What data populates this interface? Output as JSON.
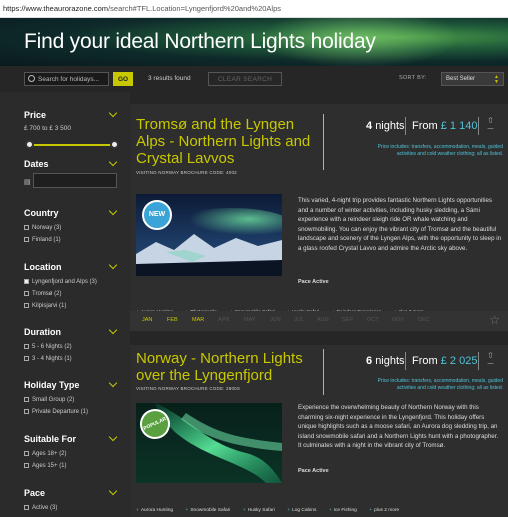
{
  "browser": {
    "url_host": "https://www.theaurorazone.com",
    "url_path": "/search#TFL.Location=Lyngenfjord%20and%20Alps"
  },
  "hero": {
    "title": "Find your ideal Northern Lights holiday"
  },
  "toolbar": {
    "search_placeholder": "Search for holidays...",
    "go_label": "GO",
    "results_text": "3 results found",
    "clear_label": "CLEAR SEARCH",
    "sort_label": "SORT BY:",
    "sort_value": "Best Seller"
  },
  "sidebar": {
    "price": {
      "title": "Price",
      "range": "£ 700 to £ 3 500"
    },
    "dates": {
      "title": "Dates"
    },
    "country": {
      "title": "Country",
      "options": [
        {
          "label": "Norway (3)",
          "checked": false
        },
        {
          "label": "Finland (1)",
          "checked": false
        }
      ]
    },
    "location": {
      "title": "Location",
      "options": [
        {
          "label": "Lyngenfjord and Alps (3)",
          "checked": true
        },
        {
          "label": "Tromsø (2)",
          "checked": false
        },
        {
          "label": "Kilpisjarvi (1)",
          "checked": false
        }
      ]
    },
    "duration": {
      "title": "Duration",
      "options": [
        {
          "label": "5 - 6 Nights (2)",
          "checked": false
        },
        {
          "label": "3 - 4 Nights (1)",
          "checked": false
        }
      ]
    },
    "holiday_type": {
      "title": "Holiday Type",
      "options": [
        {
          "label": "Small Group (2)",
          "checked": false
        },
        {
          "label": "Private Departure (1)",
          "checked": false
        }
      ]
    },
    "suitable_for": {
      "title": "Suitable For",
      "options": [
        {
          "label": "Ages 18+ (2)",
          "checked": false
        },
        {
          "label": "Ages 15+ (1)",
          "checked": false
        }
      ]
    },
    "pace": {
      "title": "Pace",
      "options": [
        {
          "label": "Active (3)",
          "checked": false
        }
      ]
    }
  },
  "cards": [
    {
      "title_lines": [
        "Tromsø and the Lyngen",
        "Alps - Northern Lights and",
        "Crystal Lavvos"
      ],
      "code": "VISITING NORWAY BROCHURE CODE: 4002",
      "nights_num": "4",
      "nights_word": "nights",
      "from_label": "From",
      "price": "£ 1 140",
      "includes_lines": [
        "Price includes: transfers, accommodation, meals, guided",
        "activities and cold weather clothing; all as listed."
      ],
      "badge": "NEW",
      "description": "This varied, 4-night trip provides fantastic Northern Lights opportunities and a number of winter activities, including husky sledding, a Sámi experience with a reindeer sleigh ride OR whale watching and snowmobiling. You can enjoy the vibrant city of Tromsø and the beautiful landscape and scenery of the Lyngen Alps, with the opportunity to sleep in a glass roofed Crystal Lavvo and admire the Arctic sky above.",
      "pace": "Pace Active",
      "tags": [
        "Aurora Hunting",
        "Photography",
        "Snowmobile Safari",
        "Husky Safari",
        "Reindeer Experience",
        "plus 2 more"
      ],
      "months": [
        {
          "m": "JAN",
          "on": true
        },
        {
          "m": "FEB",
          "on": true
        },
        {
          "m": "MAR",
          "on": true
        },
        {
          "m": "APR",
          "on": false
        },
        {
          "m": "MAY",
          "on": false
        },
        {
          "m": "JUN",
          "on": false
        },
        {
          "m": "JUL",
          "on": false
        },
        {
          "m": "AUG",
          "on": false
        },
        {
          "m": "SEP",
          "on": false
        },
        {
          "m": "OCT",
          "on": false
        },
        {
          "m": "NOV",
          "on": false
        },
        {
          "m": "DEC",
          "on": false
        }
      ]
    },
    {
      "title_lines": [
        "Norway - Northern Lights",
        "over the Lyngenfjord"
      ],
      "code": "VISITING NORWAY BROCHURE CODE: 2800S",
      "nights_num": "6",
      "nights_word": "nights",
      "from_label": "From",
      "price": "£ 2 025",
      "includes_lines": [
        "Price includes: transfers, accommodation, meals, guided",
        "activities and cold weather clothing; all as listed."
      ],
      "badge": "POPULAR",
      "description": "Experience the overwhelming beauty of Northern Norway with this charming six-night experience in the Lyngenfjord. This holiday offers unique highlights such as a moose safari, an Aurora dog sledding trip, an island snowmobile safari and a Northern Lights hunt with a photographer. It culminates with a night in the vibrant city of Tromsø.",
      "pace": "Pace Active",
      "tags": [
        "Aurora Hunting",
        "Snowmobile Safari",
        "Husky Safari",
        "Log Cabins",
        "Ice Fishing",
        "plus 2 more"
      ]
    }
  ],
  "colors": {
    "accent": "#c8c800",
    "price": "#4fc3d9",
    "panel": "#2b2b2b"
  }
}
